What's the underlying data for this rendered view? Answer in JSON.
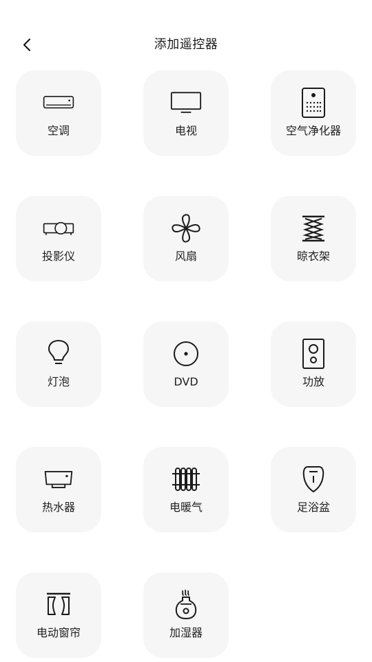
{
  "header": {
    "back_icon": "chevron-left-icon",
    "title": "添加遥控器"
  },
  "devices": [
    {
      "label": "空调",
      "icon": "air-conditioner-icon"
    },
    {
      "label": "电视",
      "icon": "tv-icon"
    },
    {
      "label": "空气净化器",
      "icon": "air-purifier-icon"
    },
    {
      "label": "投影仪",
      "icon": "projector-icon"
    },
    {
      "label": "风扇",
      "icon": "fan-icon"
    },
    {
      "label": "晾衣架",
      "icon": "clothes-rack-icon"
    },
    {
      "label": "灯泡",
      "icon": "light-bulb-icon"
    },
    {
      "label": "DVD",
      "icon": "dvd-icon"
    },
    {
      "label": "功放",
      "icon": "amplifier-icon"
    },
    {
      "label": "热水器",
      "icon": "water-heater-icon"
    },
    {
      "label": "电暖气",
      "icon": "radiator-icon"
    },
    {
      "label": "足浴盆",
      "icon": "foot-bath-icon"
    },
    {
      "label": "电动窗帘",
      "icon": "curtain-icon"
    },
    {
      "label": "加湿器",
      "icon": "humidifier-icon"
    }
  ]
}
